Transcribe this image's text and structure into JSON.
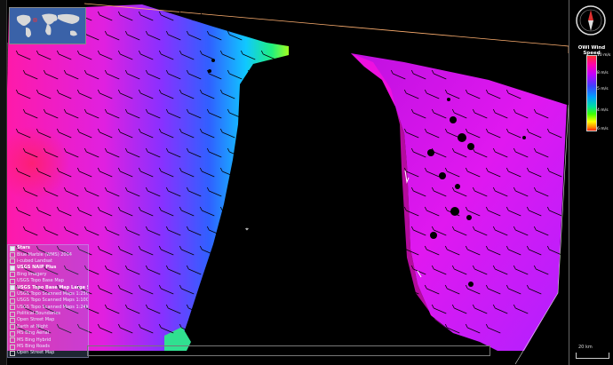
{
  "legend": {
    "title": "OWI Wind Speed",
    "ticks": [
      "10 m/s",
      "8 m/s",
      "5 m/s",
      "4 m/s",
      "6 m/s"
    ]
  },
  "scale": {
    "label": "20 km"
  },
  "layers": [
    {
      "label": "Stars",
      "checked": true,
      "group": true
    },
    {
      "label": "Blue Marble (WMS) 2004",
      "checked": false,
      "group": false
    },
    {
      "label": "i-cubed Landsat",
      "checked": false,
      "group": false
    },
    {
      "label": "USGS NAIP Plus",
      "checked": true,
      "group": true
    },
    {
      "label": "Bing Imagery",
      "checked": false,
      "group": false
    },
    {
      "label": "USGS Topo Base Map",
      "checked": false,
      "group": false
    },
    {
      "label": "USGS Topo Base Map Large Scale",
      "checked": true,
      "group": true
    },
    {
      "label": "USGS Topo Scanned Maps 1:250K",
      "checked": false,
      "group": false
    },
    {
      "label": "USGS Topo Scanned Maps 1:100K",
      "checked": false,
      "group": false
    },
    {
      "label": "USGS Topo Scanned Maps 1:24K",
      "checked": false,
      "group": false
    },
    {
      "label": "Political Boundaries",
      "checked": false,
      "group": false
    },
    {
      "label": "Open Street Map",
      "checked": false,
      "group": false
    },
    {
      "label": "Earth at Night",
      "checked": false,
      "group": false
    },
    {
      "label": "MS Bing Aerial",
      "checked": false,
      "group": false
    },
    {
      "label": "MS Bing Hybrid",
      "checked": false,
      "group": false
    },
    {
      "label": "MS Bing Roads",
      "checked": false,
      "group": false
    },
    {
      "label": "Open Street Map",
      "checked": false,
      "group": false
    },
    {
      "label": "Products",
      "checked": true,
      "group": true
    },
    {
      "label": "3.1 Layers & COM",
      "checked": true,
      "group": true
    },
    {
      "label": "Place Names",
      "checked": true,
      "group": true
    },
    {
      "label": "Layer List",
      "checked": false,
      "group": false
    }
  ]
}
